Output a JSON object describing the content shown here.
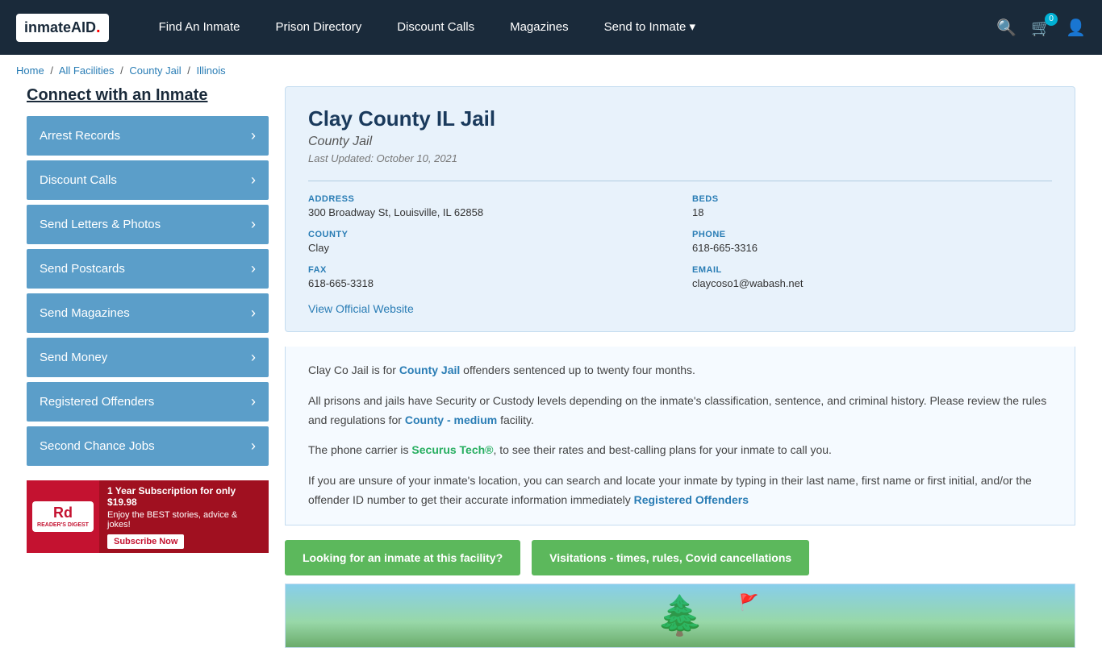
{
  "navbar": {
    "logo": "inmateAID",
    "links": [
      {
        "id": "find-inmate",
        "label": "Find An Inmate"
      },
      {
        "id": "prison-directory",
        "label": "Prison Directory"
      },
      {
        "id": "discount-calls",
        "label": "Discount Calls"
      },
      {
        "id": "magazines",
        "label": "Magazines"
      },
      {
        "id": "send-to-inmate",
        "label": "Send to Inmate"
      }
    ],
    "cart_count": "0",
    "icons": {
      "search": "🔍",
      "cart": "🛒",
      "user": "👤"
    }
  },
  "breadcrumb": {
    "items": [
      {
        "label": "Home",
        "href": "#"
      },
      {
        "label": "All Facilities",
        "href": "#"
      },
      {
        "label": "County Jail",
        "href": "#"
      },
      {
        "label": "Illinois",
        "href": "#"
      }
    ]
  },
  "sidebar": {
    "title": "Connect with an Inmate",
    "items": [
      {
        "id": "arrest-records",
        "label": "Arrest Records"
      },
      {
        "id": "discount-calls",
        "label": "Discount Calls"
      },
      {
        "id": "send-letters-photos",
        "label": "Send Letters & Photos"
      },
      {
        "id": "send-postcards",
        "label": "Send Postcards"
      },
      {
        "id": "send-magazines",
        "label": "Send Magazines"
      },
      {
        "id": "send-money",
        "label": "Send Money"
      },
      {
        "id": "registered-offenders",
        "label": "Registered Offenders"
      },
      {
        "id": "second-chance-jobs",
        "label": "Second Chance Jobs"
      }
    ],
    "ad": {
      "logo_line1": "Rd",
      "logo_line2": "READER'S DIGEST",
      "title": "1 Year Subscription for only $19.98",
      "body": "Enjoy the BEST stories, advice & jokes!",
      "button": "Subscribe Now"
    }
  },
  "facility": {
    "name": "Clay County IL Jail",
    "type": "County Jail",
    "last_updated": "Last Updated: October 10, 2021",
    "address_label": "ADDRESS",
    "address_value": "300 Broadway St, Louisville, IL 62858",
    "beds_label": "BEDS",
    "beds_value": "18",
    "county_label": "COUNTY",
    "county_value": "Clay",
    "phone_label": "PHONE",
    "phone_value": "618-665-3316",
    "fax_label": "FAX",
    "fax_value": "618-665-3318",
    "email_label": "EMAIL",
    "email_value": "claycoso1@wabash.net",
    "website_label": "View Official Website",
    "website_href": "#"
  },
  "description": {
    "para1": "Clay Co Jail is for ",
    "para1_link": "County Jail",
    "para1_end": " offenders sentenced up to twenty four months.",
    "para2": "All prisons and jails have Security or Custody levels depending on the inmate's classification, sentence, and criminal history. Please review the rules and regulations for ",
    "para2_link": "County - medium",
    "para2_end": " facility.",
    "para3": "The phone carrier is ",
    "para3_link": "Securus Tech®",
    "para3_end": ", to see their rates and best-calling plans for your inmate to call you.",
    "para4_start": "If you are unsure of your inmate's location, you can search and locate your inmate by typing in their last name, first name or first initial, and/or the offender ID number to get their accurate information immediately ",
    "para4_link": "Registered Offenders",
    "para4_end": ""
  },
  "action_buttons": {
    "btn1": "Looking for an inmate at this facility?",
    "btn2": "Visitations - times, rules, Covid cancellations"
  }
}
